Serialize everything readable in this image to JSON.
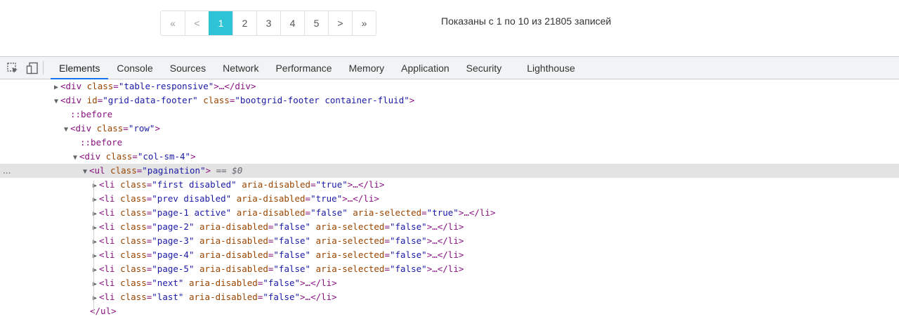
{
  "pagination": {
    "first": "«",
    "prev": "<",
    "pages": [
      "1",
      "2",
      "3",
      "4",
      "5"
    ],
    "next": ">",
    "last": "»",
    "info": "Показаны с 1 по 10 из 21805 записей"
  },
  "colors": {
    "accent": "#2ec4d6",
    "tab_underline": "#1a73e8",
    "tag": "#881280",
    "attr_name": "#994500",
    "attr_value": "#1a1aa6"
  },
  "devtools": {
    "icons": [
      "inspect-icon",
      "device-toolbar-icon"
    ],
    "tabs": [
      "Elements",
      "Console",
      "Sources",
      "Network",
      "Performance",
      "Memory",
      "Application",
      "Security",
      "Lighthouse"
    ],
    "dom": {
      "l1": {
        "open": "<div ",
        "a1": "class",
        "v1": "\"table-responsive\"",
        "close": ">…</div>"
      },
      "l2": {
        "open": "<div ",
        "a1": "id",
        "v1": "\"grid-data-footer\"",
        "a2": "class",
        "v2": "\"bootgrid-footer container-fluid\"",
        "close": ">"
      },
      "l3": "::before",
      "l4": {
        "open": "<div ",
        "a1": "class",
        "v1": "\"row\"",
        "close": ">"
      },
      "l5": "::before",
      "l6": {
        "open": "<div ",
        "a1": "class",
        "v1": "\"col-sm-4\"",
        "close": ">"
      },
      "l7": {
        "gutter": "...",
        "open": "<ul ",
        "a1": "class",
        "v1": "\"pagination\"",
        "close": ">",
        "marker": " == $0"
      },
      "l8": {
        "open": "<li ",
        "a1": "class",
        "v1": "\"first disabled\"",
        "a2": "aria-disabled",
        "v2": "\"true\"",
        "close": ">…</li>"
      },
      "l9": {
        "open": "<li ",
        "a1": "class",
        "v1": "\"prev disabled\"",
        "a2": "aria-disabled",
        "v2": "\"true\"",
        "close": ">…</li>"
      },
      "l10": {
        "open": "<li ",
        "a1": "class",
        "v1": "\"page-1 active\"",
        "a2": "aria-disabled",
        "v2": "\"false\"",
        "a3": "aria-selected",
        "v3": "\"true\"",
        "close": ">…</li>"
      },
      "l11": {
        "open": "<li ",
        "a1": "class",
        "v1": "\"page-2\"",
        "a2": "aria-disabled",
        "v2": "\"false\"",
        "a3": "aria-selected",
        "v3": "\"false\"",
        "close": ">…</li>"
      },
      "l12": {
        "open": "<li ",
        "a1": "class",
        "v1": "\"page-3\"",
        "a2": "aria-disabled",
        "v2": "\"false\"",
        "a3": "aria-selected",
        "v3": "\"false\"",
        "close": ">…</li>"
      },
      "l13": {
        "open": "<li ",
        "a1": "class",
        "v1": "\"page-4\"",
        "a2": "aria-disabled",
        "v2": "\"false\"",
        "a3": "aria-selected",
        "v3": "\"false\"",
        "close": ">…</li>"
      },
      "l14": {
        "open": "<li ",
        "a1": "class",
        "v1": "\"page-5\"",
        "a2": "aria-disabled",
        "v2": "\"false\"",
        "a3": "aria-selected",
        "v3": "\"false\"",
        "close": ">…</li>"
      },
      "l15": {
        "open": "<li ",
        "a1": "class",
        "v1": "\"next\"",
        "a2": "aria-disabled",
        "v2": "\"false\"",
        "close": ">…</li>"
      },
      "l16": {
        "open": "<li ",
        "a1": "class",
        "v1": "\"last\"",
        "a2": "aria-disabled",
        "v2": "\"false\"",
        "close": ">…</li>"
      },
      "l17": "</ul>"
    }
  }
}
